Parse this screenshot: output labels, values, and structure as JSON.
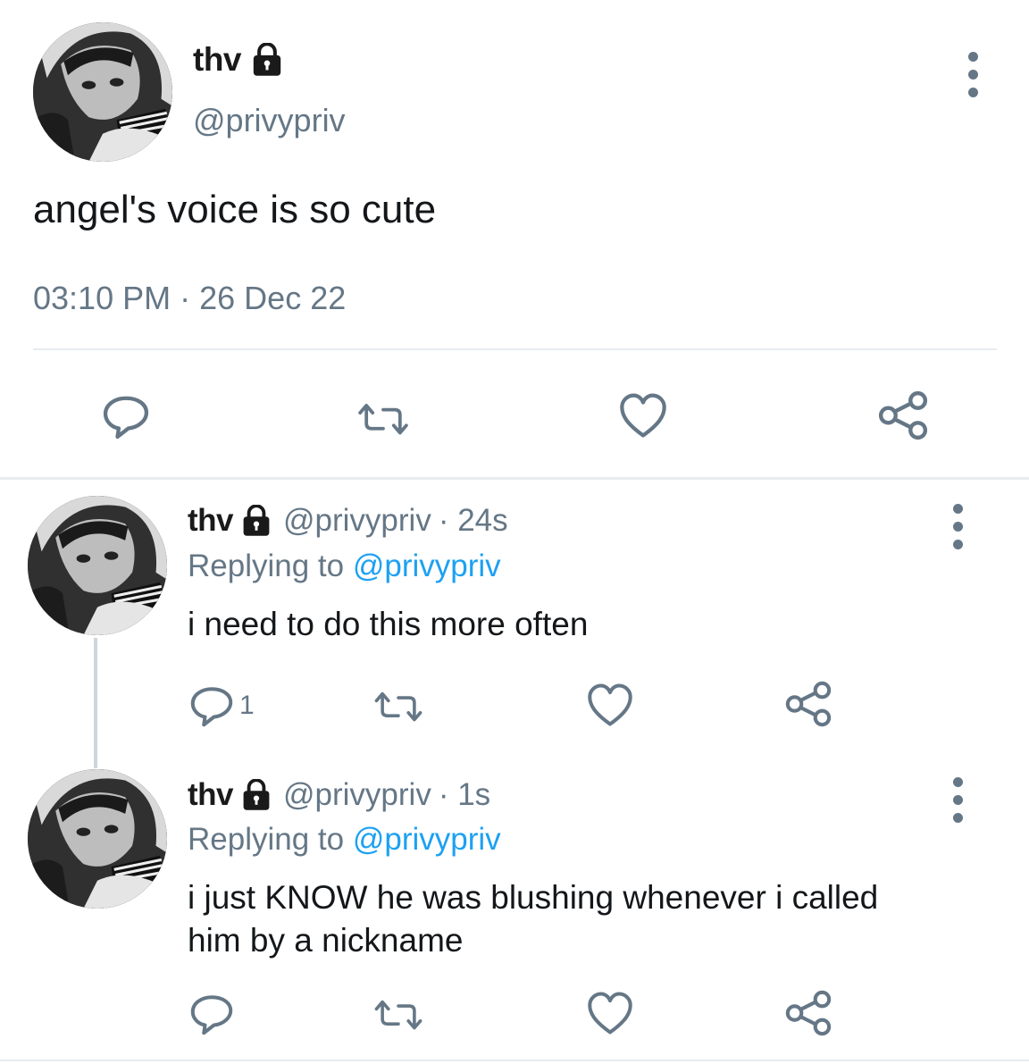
{
  "main_tweet": {
    "name": "thv",
    "handle": "@privypriv",
    "text": "angel's voice is so cute",
    "time": "03:10 PM",
    "dot": "·",
    "date": "26 Dec 22",
    "icons": [
      "lock-icon",
      "more-vertical-icon",
      "reply-icon",
      "retweet-icon",
      "like-icon",
      "share-icon"
    ]
  },
  "replies": [
    {
      "name": "thv",
      "handle": "@privypriv",
      "age": "· 24s",
      "replying_label": "Replying to",
      "replying_to": "@privypriv",
      "text_lines": [
        "i need to do this more often"
      ],
      "reply_count": "1"
    },
    {
      "name": "thv",
      "handle": "@privypriv",
      "age": "· 1s",
      "replying_label": "Replying to",
      "replying_to": "@privypriv",
      "text_lines": [
        "i just KNOW he was blushing whenever i called",
        "him by a nickname"
      ],
      "reply_count": ""
    }
  ],
  "colors": {
    "text": "#14171a",
    "secondary": "#657786",
    "link": "#1da1f2",
    "divider": "#e6ecf0"
  }
}
